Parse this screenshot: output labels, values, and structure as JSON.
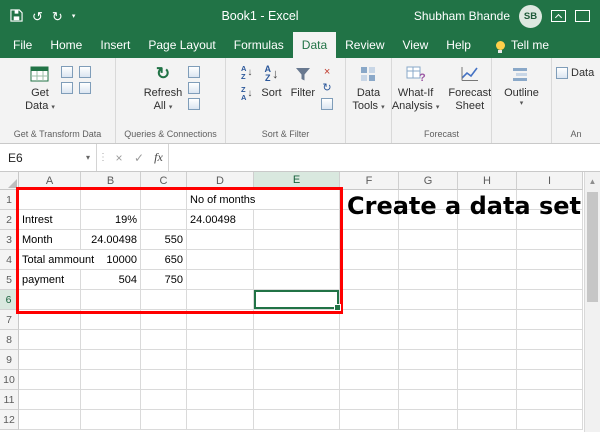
{
  "title_bar": {
    "title": "Book1 - Excel",
    "user_name": "Shubham Bhande",
    "user_initials": "SB"
  },
  "ribbon_tabs": {
    "items": [
      {
        "label": "File",
        "active": false
      },
      {
        "label": "Home",
        "active": false
      },
      {
        "label": "Insert",
        "active": false
      },
      {
        "label": "Page Layout",
        "active": false
      },
      {
        "label": "Formulas",
        "active": false
      },
      {
        "label": "Data",
        "active": true
      },
      {
        "label": "Review",
        "active": false
      },
      {
        "label": "View",
        "active": false
      },
      {
        "label": "Help",
        "active": false
      }
    ],
    "tell_me": "Tell me"
  },
  "ribbon": {
    "get_data": {
      "line1": "Get",
      "line2": "Data"
    },
    "get_transform_group_label": "Get & Transform Data",
    "refresh_all": {
      "line1": "Refresh",
      "line2": "All"
    },
    "queries_group_label": "Queries & Connections",
    "sort_button": "Sort",
    "filter_button": "Filter",
    "sort_filter_group_label": "Sort & Filter",
    "data_tools": {
      "line1": "Data",
      "line2": "Tools"
    },
    "what_if": {
      "line1": "What-If",
      "line2": "Analysis"
    },
    "forecast_sheet": {
      "line1": "Forecast",
      "line2": "Sheet"
    },
    "forecast_group_label": "Forecast",
    "outline_button": "Outline",
    "analysis_button_label": "Data",
    "analysis_group_label": "An"
  },
  "formula_bar": {
    "name_box": "E6",
    "formula_value": ""
  },
  "grid": {
    "selected_cell": "E6",
    "columns": [
      "A",
      "B",
      "C",
      "D",
      "E",
      "F",
      "G",
      "H",
      "I"
    ],
    "row_count": 12,
    "cells": [
      {
        "ref": "D1",
        "col": "D",
        "row": 1,
        "value": "No of months",
        "align": "left"
      },
      {
        "ref": "A2",
        "col": "A",
        "row": 2,
        "value": "Intrest",
        "align": "left"
      },
      {
        "ref": "B2",
        "col": "B",
        "row": 2,
        "value": "19%",
        "align": "right"
      },
      {
        "ref": "D2",
        "col": "D",
        "row": 2,
        "value": "24.00498",
        "align": "left"
      },
      {
        "ref": "A3",
        "col": "A",
        "row": 3,
        "value": "Month",
        "align": "left"
      },
      {
        "ref": "B3",
        "col": "B",
        "row": 3,
        "value": "24.00498",
        "align": "right"
      },
      {
        "ref": "C3",
        "col": "C",
        "row": 3,
        "value": "550",
        "align": "right"
      },
      {
        "ref": "A4",
        "col": "A",
        "row": 4,
        "value": "Total ammount",
        "align": "left"
      },
      {
        "ref": "B4",
        "col": "B",
        "row": 4,
        "value": "10000",
        "align": "right"
      },
      {
        "ref": "C4",
        "col": "C",
        "row": 4,
        "value": "650",
        "align": "right"
      },
      {
        "ref": "A5",
        "col": "A",
        "row": 5,
        "value": "payment",
        "align": "left"
      },
      {
        "ref": "B5",
        "col": "B",
        "row": 5,
        "value": "504",
        "align": "right"
      },
      {
        "ref": "C5",
        "col": "C",
        "row": 5,
        "value": "750",
        "align": "right"
      }
    ]
  },
  "annotation": {
    "callout_text": "Create a data set"
  },
  "icons": {
    "dropdown": "▾",
    "undo": "↺",
    "redo": "↻",
    "refresh": "↻",
    "sort_a": "A",
    "sort_z": "Z",
    "arrow_down": "↓",
    "cancel": "×",
    "enter": "✓",
    "fx": "fx",
    "splitter_dots": "⋮",
    "scroll_up": "▲",
    "question": "?"
  },
  "colors": {
    "excel_green": "#217346",
    "annotation_red": "#ff0000"
  }
}
